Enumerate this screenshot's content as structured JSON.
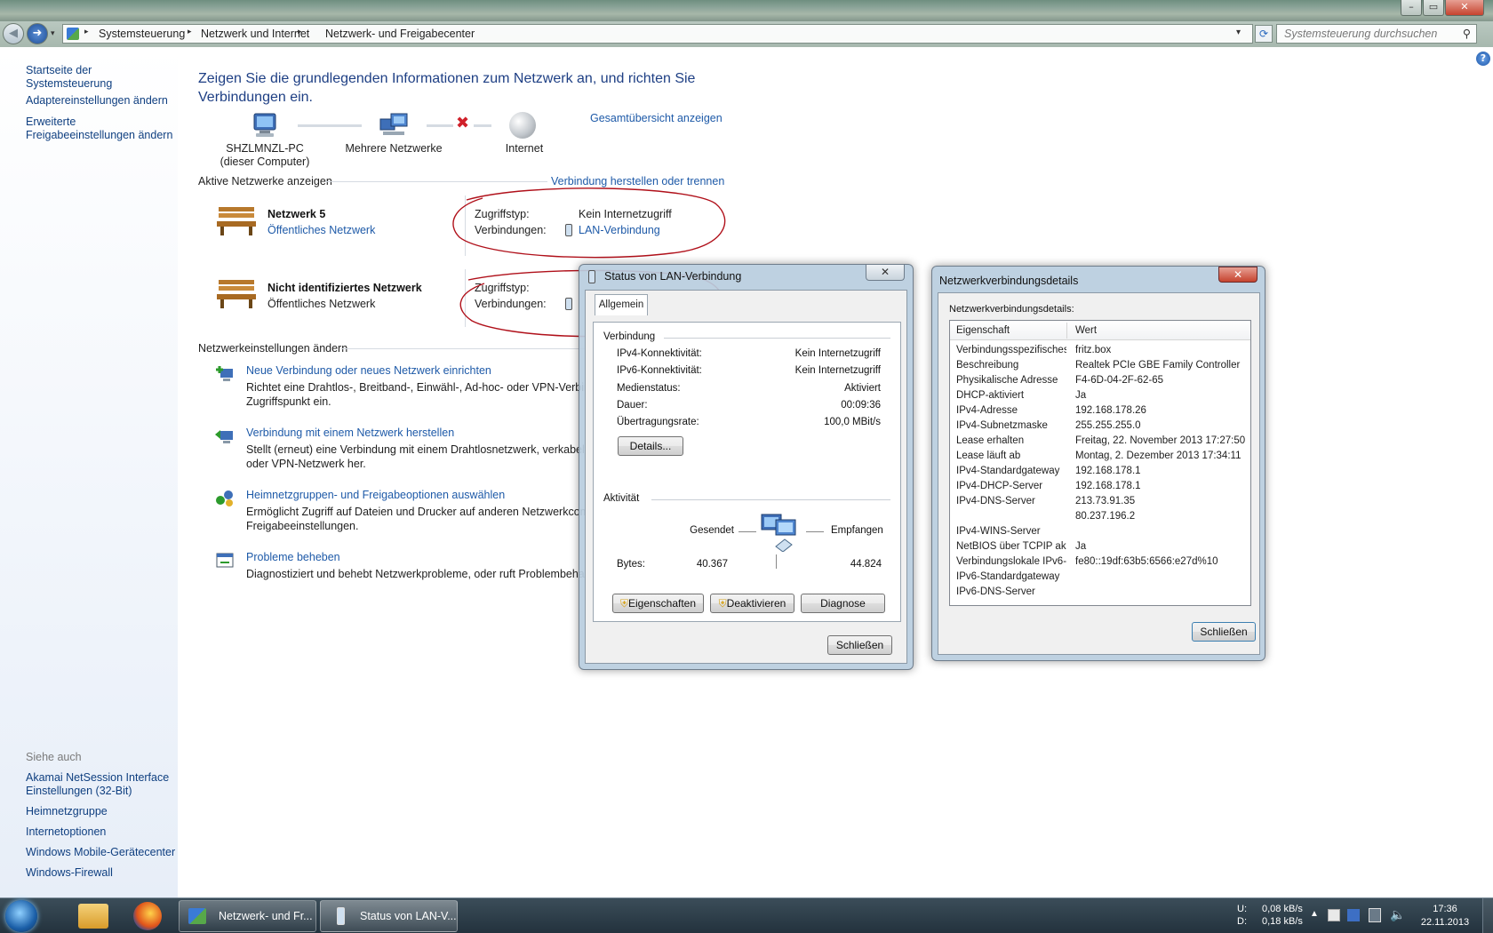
{
  "window": {
    "minimize": "–",
    "maximize": "▭",
    "close": "✕"
  },
  "address": {
    "crumbs": [
      "Systemsteuerung",
      "Netzwerk und Internet",
      "Netzwerk- und Freigabecenter"
    ],
    "search_placeholder": "Systemsteuerung durchsuchen"
  },
  "sidebar": {
    "items": [
      "Startseite der Systemsteuerung",
      "Adaptereinstellungen ändern",
      "Erweiterte",
      "Freigabeeinstellungen ändern"
    ],
    "see_also_title": "Siehe auch",
    "see_also": [
      "Akamai NetSession Interface",
      "Einstellungen (32-Bit)",
      "Heimnetzgruppe",
      "Internetoptionen",
      "Windows Mobile-Gerätecenter",
      "Windows-Firewall"
    ]
  },
  "main": {
    "heading_line1": "Zeigen Sie die grundlegenden Informationen zum Netzwerk an, und richten Sie",
    "heading_line2": "Verbindungen ein.",
    "map_link": "Gesamtübersicht anzeigen",
    "map": {
      "pc_name": "SHZLMNZL-PC",
      "pc_sub": "(dieser Computer)",
      "middle": "Mehrere Netzwerke",
      "internet": "Internet"
    },
    "active_title": "Aktive Netzwerke anzeigen",
    "connect_link": "Verbindung herstellen oder trennen",
    "networks": [
      {
        "name": "Netzwerk  5",
        "type": "Öffentliches Netzwerk",
        "access_label": "Zugriffstyp:",
        "access_value": "Kein Internetzugriff",
        "conn_label": "Verbindungen:",
        "conn_value": "LAN-Verbindung"
      },
      {
        "name": "Nicht identifiziertes Netzwerk",
        "type": "Öffentliches Netzwerk",
        "access_label": "Zugriffstyp:",
        "conn_label": "Verbindungen:"
      }
    ],
    "change_title": "Netzwerkeinstellungen ändern",
    "tasks": [
      {
        "title": "Neue Verbindung oder neues Netzwerk einrichten",
        "desc1": "Richtet eine Drahtlos-, Breitband-, Einwähl-, Ad-hoc- oder VPN-Verbind",
        "desc2": "Zugriffspunkt ein."
      },
      {
        "title": "Verbindung mit einem Netzwerk herstellen",
        "desc1": "Stellt (erneut) eine Verbindung mit einem Drahtlosnetzwerk, verkabelte",
        "desc2": "oder VPN-Netzwerk her."
      },
      {
        "title": "Heimnetzgruppen- und Freigabeoptionen auswählen",
        "desc1": "Ermöglicht Zugriff auf Dateien und Drucker auf anderen Netzwerkcomp",
        "desc2": "Freigabeeinstellungen."
      },
      {
        "title": "Probleme beheben",
        "desc1": "Diagnostiziert und behebt Netzwerkprobleme, oder ruft Problembehan",
        "desc2": ""
      }
    ]
  },
  "status_dialog": {
    "title": "Status von LAN-Verbindung",
    "tab": "Allgemein",
    "section_conn": "Verbindung",
    "rows": [
      {
        "k": "IPv4-Konnektivität:",
        "v": "Kein Internetzugriff"
      },
      {
        "k": "IPv6-Konnektivität:",
        "v": "Kein Internetzugriff"
      },
      {
        "k": "Medienstatus:",
        "v": "Aktiviert"
      },
      {
        "k": "Dauer:",
        "v": "00:09:36"
      },
      {
        "k": "Übertragungsrate:",
        "v": "100,0 MBit/s"
      }
    ],
    "details_btn": "Details...",
    "section_activity": "Aktivität",
    "sent": "Gesendet",
    "received": "Empfangen",
    "bytes_label": "Bytes:",
    "bytes_sent": "40.367",
    "bytes_received": "44.824",
    "btn_properties": "Eigenschaften",
    "btn_disable": "Deaktivieren",
    "btn_diagnose": "Diagnose",
    "btn_close": "Schließen"
  },
  "details_dialog": {
    "title": "Netzwerkverbindungsdetails",
    "caption": "Netzwerkverbindungsdetails:",
    "col_property": "Eigenschaft",
    "col_value": "Wert",
    "rows": [
      {
        "k": "Verbindungsspezifisches...",
        "v": "fritz.box"
      },
      {
        "k": "Beschreibung",
        "v": "Realtek PCIe GBE Family Controller"
      },
      {
        "k": "Physikalische Adresse",
        "v": "F4-6D-04-2F-62-65"
      },
      {
        "k": "DHCP-aktiviert",
        "v": "Ja"
      },
      {
        "k": "IPv4-Adresse",
        "v": "192.168.178.26"
      },
      {
        "k": "IPv4-Subnetzmaske",
        "v": "255.255.255.0"
      },
      {
        "k": "Lease erhalten",
        "v": "Freitag, 22. November 2013 17:27:50"
      },
      {
        "k": "Lease läuft ab",
        "v": "Montag, 2. Dezember 2013 17:34:11"
      },
      {
        "k": "IPv4-Standardgateway",
        "v": "192.168.178.1"
      },
      {
        "k": "IPv4-DHCP-Server",
        "v": "192.168.178.1"
      },
      {
        "k": "IPv4-DNS-Server",
        "v": "213.73.91.35"
      },
      {
        "k": "",
        "v": "80.237.196.2"
      },
      {
        "k": "IPv4-WINS-Server",
        "v": ""
      },
      {
        "k": "NetBIOS über TCPIP ak...",
        "v": "Ja"
      },
      {
        "k": "Verbindungslokale IPv6-...",
        "v": "fe80::19df:63b5:6566:e27d%10"
      },
      {
        "k": "IPv6-Standardgateway",
        "v": ""
      },
      {
        "k": "IPv6-DNS-Server",
        "v": ""
      }
    ],
    "btn_close": "Schließen"
  },
  "taskbar": {
    "task1": "Netzwerk- und Fr...",
    "task2": "Status von LAN-V...",
    "up_label": "U:",
    "down_label": "D:",
    "up_rate": "0,08 kB/s",
    "down_rate": "0,18 kB/s",
    "time": "17:36",
    "date": "22.11.2013"
  },
  "colors": {
    "link": "#1e5aa8",
    "heading": "#1e3f84",
    "annotation": "#b0101a",
    "taskbar": "#23323d"
  }
}
